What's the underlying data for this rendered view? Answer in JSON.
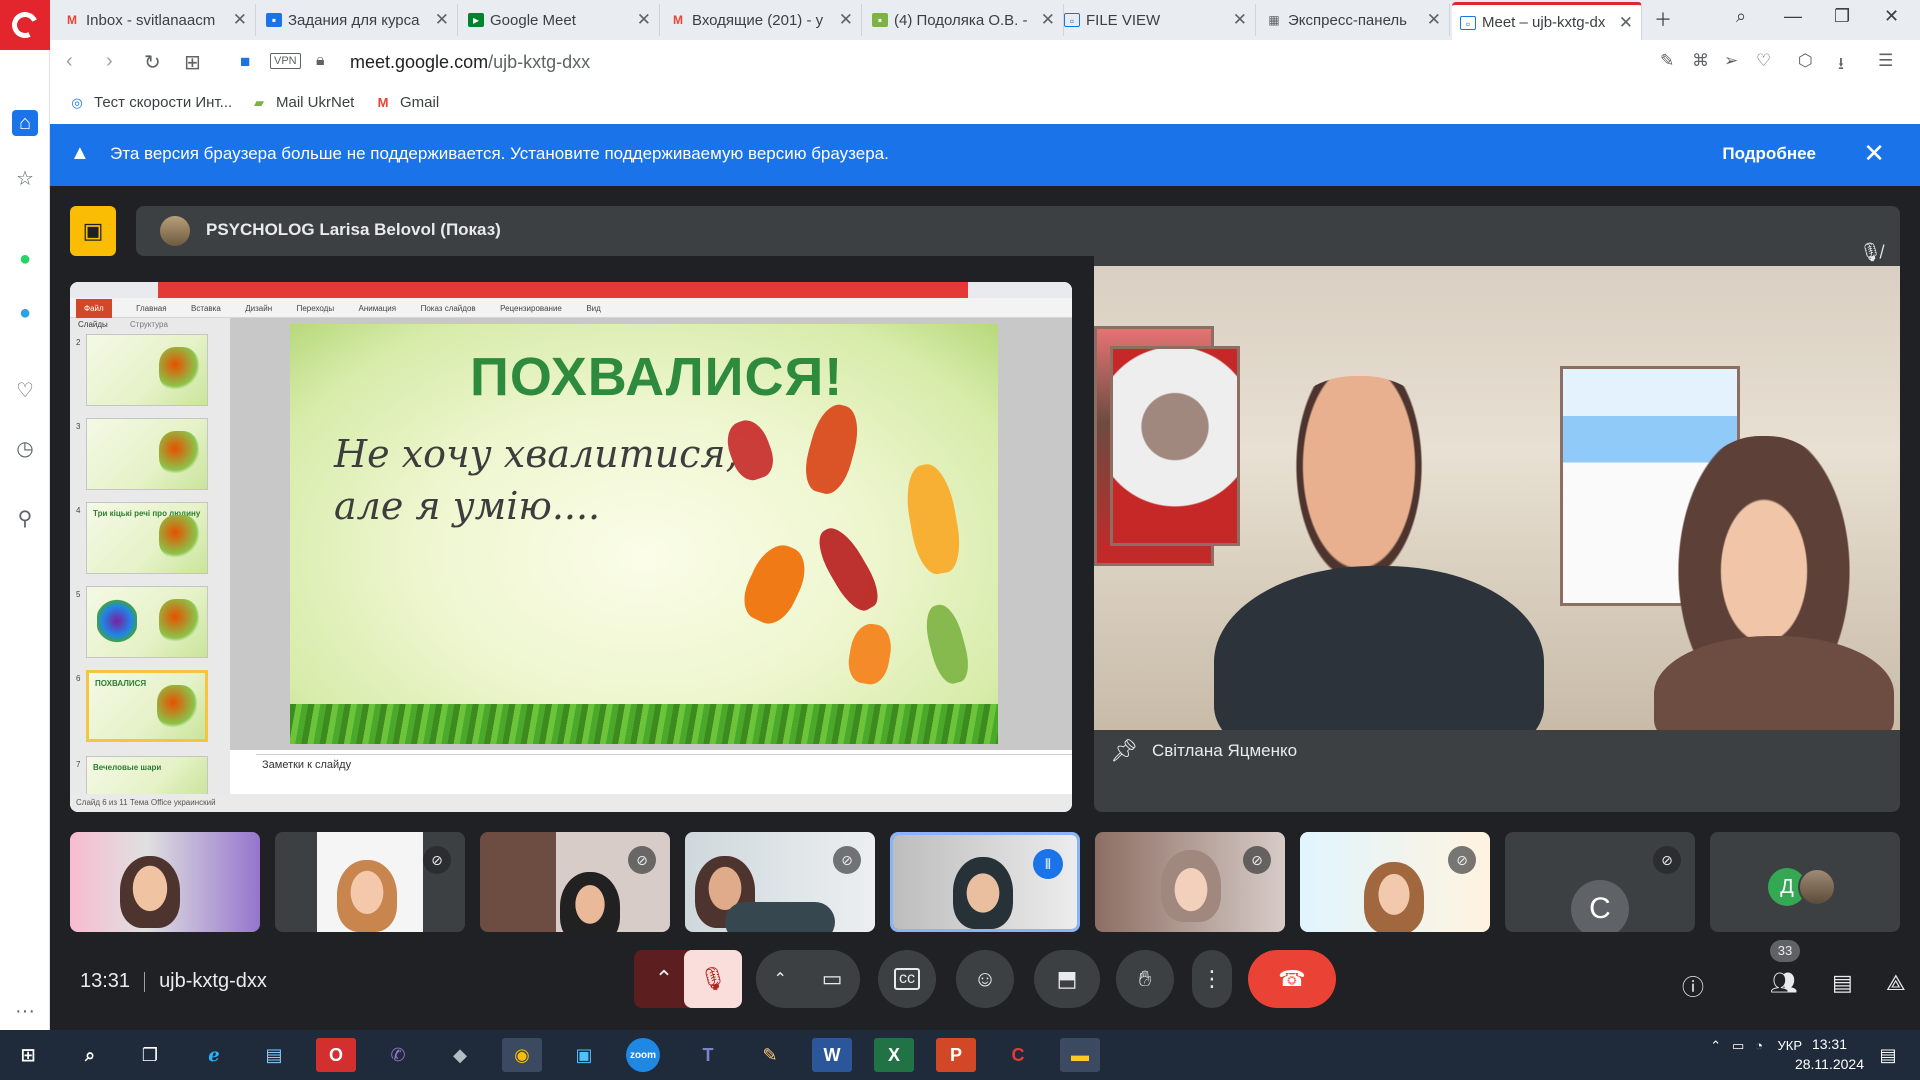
{
  "browser": {
    "tabs": [
      {
        "label": "Inbox - svitlanaacm",
        "icon": "gmail-icon",
        "color": "#ea4335"
      },
      {
        "label": "Задания для курса",
        "icon": "classroom-icon",
        "color": "#1a73e8"
      },
      {
        "label": "Google Meet",
        "icon": "meet-icon",
        "color": "#00832d"
      },
      {
        "label": "Входящие (201) - у",
        "icon": "gmail-icon",
        "color": "#ea4335"
      },
      {
        "label": "(4) Подоляка О.В. -",
        "icon": "doc-icon",
        "color": "#7cb342"
      },
      {
        "label": "FILE VIEW",
        "icon": "file-view-icon",
        "color": "#1a73e8"
      },
      {
        "label": "Экспресс-панель",
        "icon": "speed-dial-icon",
        "color": "#5f6368"
      },
      {
        "label": "Meet – ujb-kxtg-dx",
        "icon": "meet-icon",
        "color": "#1a73e8",
        "active": true
      }
    ],
    "vpn_label": "VPN",
    "url_domain": "meet.google.com",
    "url_path": "/ujb-kxtg-dxx",
    "bookmarks": [
      {
        "label": "Тест скорости Инт...",
        "icon": "speedtest-icon"
      },
      {
        "label": "Mail UkrNet",
        "icon": "mail-ukrnet-icon"
      },
      {
        "label": "Gmail",
        "icon": "gmail-icon"
      }
    ]
  },
  "banner": {
    "message": "Эта версия браузера больше не поддерживается. Установите поддерживаемую версию браузера.",
    "more_label": "Подробнее"
  },
  "meet": {
    "presenter_label": "PSYCHOLOG Larisa Belovol (Показ)",
    "presentation": {
      "ribbon_tabs": [
        "Файл",
        "Главная",
        "Вставка",
        "Дизайн",
        "Переходы",
        "Анимация",
        "Показ слайдов",
        "Рецензирование",
        "Вид"
      ],
      "panel_tabs": [
        "Слайды",
        "Структура"
      ],
      "slide_title": "ПОХВАЛИСЯ!",
      "slide_line1": "Не хочу хвалитися,",
      "slide_line2": "але я умію....",
      "notes_placeholder": "Заметки к слайду",
      "status": "Слайд 6 из 11    Тема Office    украинский",
      "thumbnails": [
        {
          "num": "2",
          "title": ""
        },
        {
          "num": "3",
          "title": ""
        },
        {
          "num": "4",
          "title": "Три кіцькі речі про людину"
        },
        {
          "num": "5",
          "title": ""
        },
        {
          "num": "6",
          "title": "ПОХВАЛИСЯ",
          "selected": true
        },
        {
          "num": "7",
          "title": "Вечеловые шари"
        }
      ]
    },
    "camera": {
      "name": "Світлана Яцменко",
      "mic_state": "muted"
    },
    "participants": [
      {
        "label": "participant-1",
        "mic": "unmuted"
      },
      {
        "label": "participant-2",
        "mic": "muted"
      },
      {
        "label": "participant-3",
        "mic": "muted"
      },
      {
        "label": "participant-4",
        "mic": "muted"
      },
      {
        "label": "participant-5",
        "mic": "speaking"
      },
      {
        "label": "participant-6",
        "mic": "muted"
      },
      {
        "label": "participant-7",
        "mic": "muted"
      },
      {
        "label": "participant-8",
        "avatar_letter": "C",
        "mic": "muted"
      },
      {
        "label": "participant-9",
        "avatar_letter": "Д"
      }
    ],
    "time": "13:31",
    "meeting_code": "ujb-kxtg-dxx",
    "people_count": "33"
  },
  "taskbar": {
    "language": "УКР",
    "time": "13:31",
    "date": "28.11.2024"
  },
  "colors": {
    "accent_red": "#e3262d",
    "banner_blue": "#1a73e8",
    "meet_bg": "#202124",
    "end_call": "#ea4335"
  }
}
